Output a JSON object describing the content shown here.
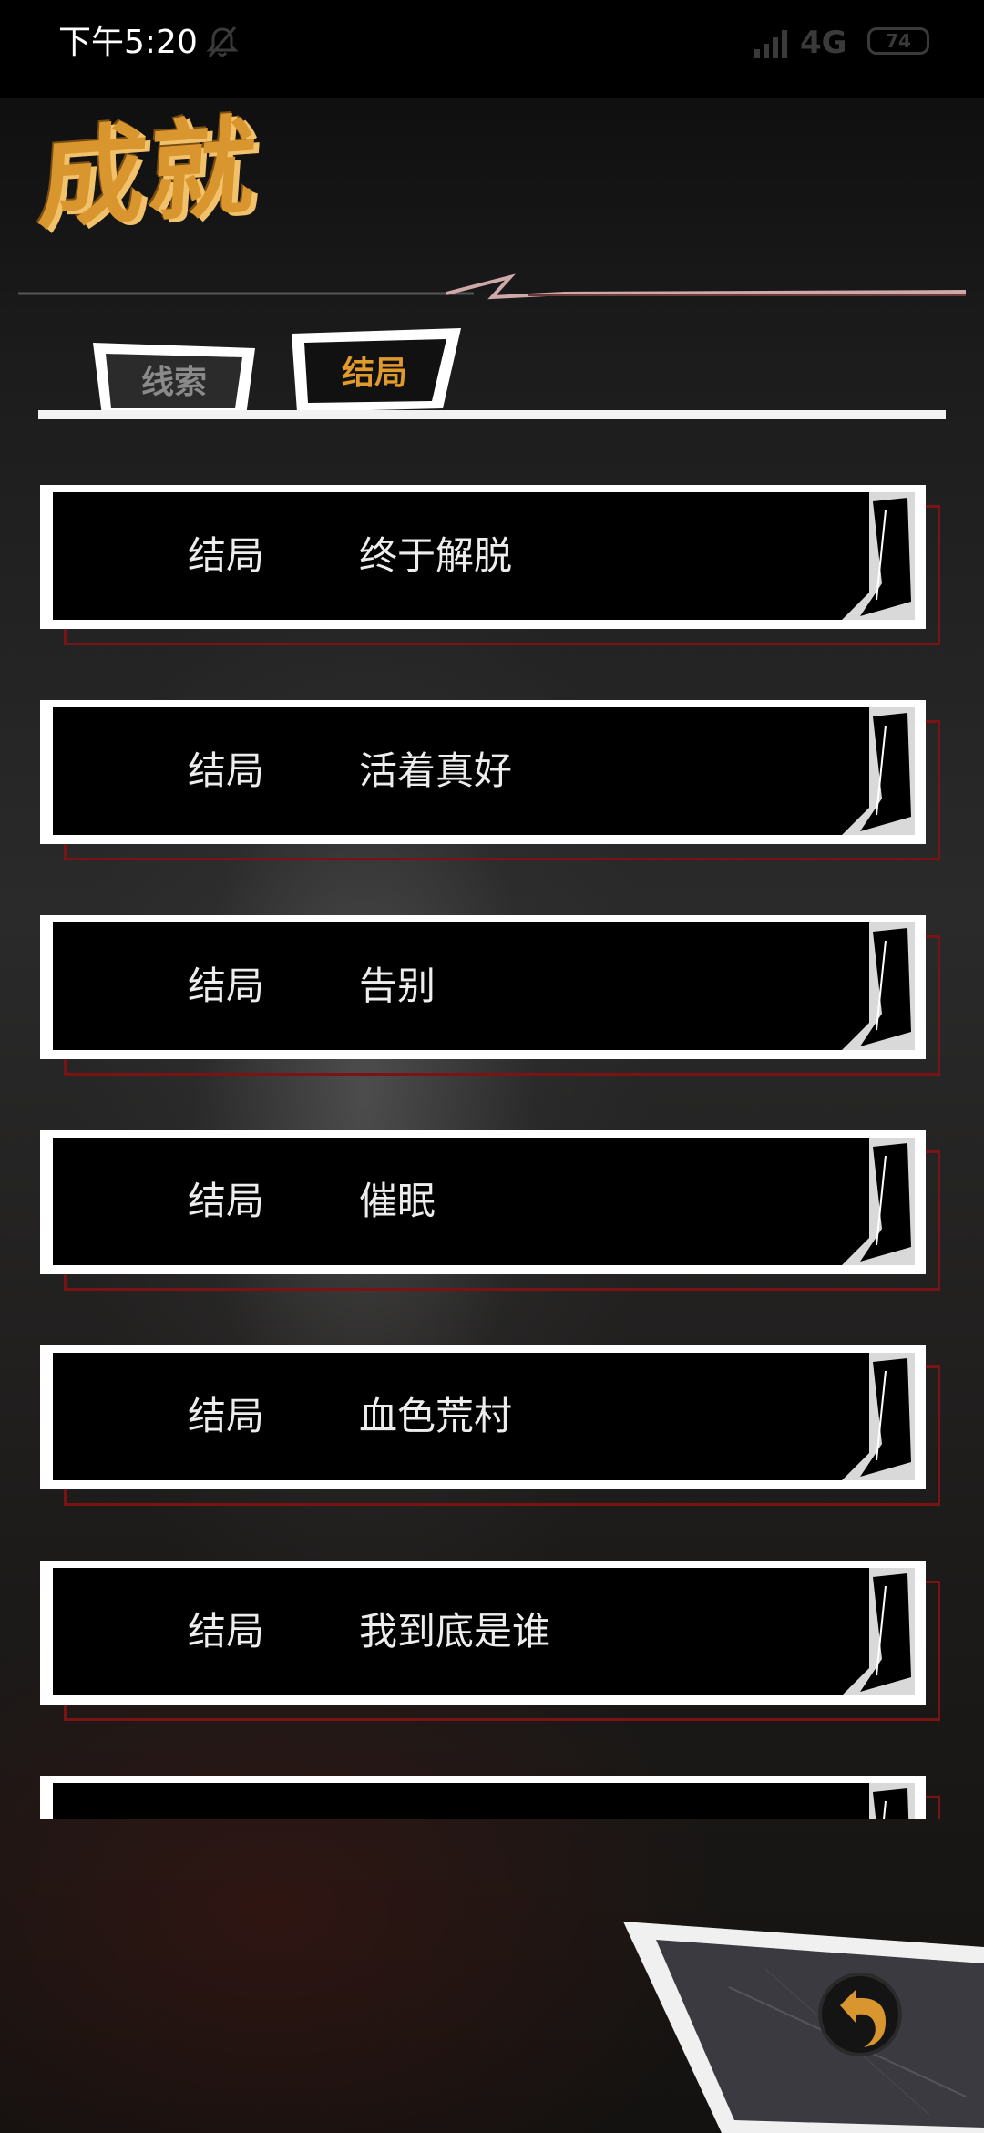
{
  "status_bar": {
    "time": "下午5:20",
    "mute_icon": "bell-off-icon",
    "signal_icon": "signal-bars-icon",
    "network": "4G",
    "battery": "74"
  },
  "header": {
    "title": "成就"
  },
  "tabs": [
    {
      "label": "线索",
      "selected": false
    },
    {
      "label": "结局",
      "selected": true
    }
  ],
  "list": {
    "items": [
      {
        "category": "结局",
        "name": "终于解脱"
      },
      {
        "category": "结局",
        "name": "活着真好"
      },
      {
        "category": "结局",
        "name": "告别"
      },
      {
        "category": "结局",
        "name": "催眠"
      },
      {
        "category": "结局",
        "name": "血色荒村"
      },
      {
        "category": "结局",
        "name": "我到底是谁"
      },
      {
        "category": "",
        "name": ""
      }
    ]
  },
  "back_button": {
    "icon": "back-arrow-icon"
  },
  "colors": {
    "accent": "#d9962e",
    "tab_active": "#e19a2c",
    "tab_inactive": "#8a8a8a",
    "item_shadow": "#7a1414",
    "item_text": "#ededed"
  }
}
